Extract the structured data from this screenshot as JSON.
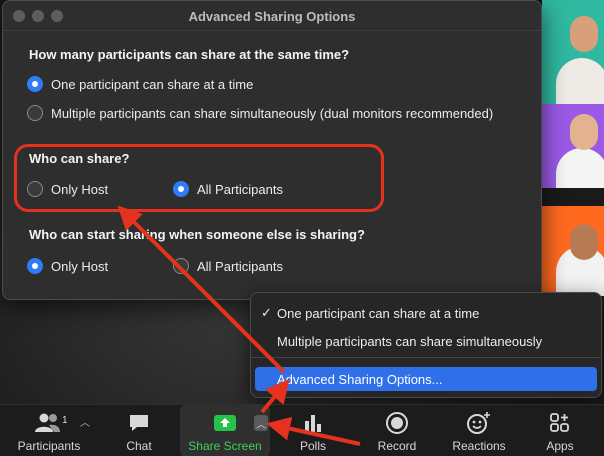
{
  "dialog": {
    "title": "Advanced Sharing Options",
    "sections": [
      {
        "heading": "How many participants can share at the same time?",
        "options": [
          {
            "label": "One participant can share at a time",
            "checked": true
          },
          {
            "label": "Multiple participants can share simultaneously (dual monitors recommended)",
            "checked": false
          }
        ]
      },
      {
        "heading": "Who can share?",
        "options": [
          {
            "label": "Only Host",
            "checked": false
          },
          {
            "label": "All Participants",
            "checked": true
          }
        ]
      },
      {
        "heading": "Who can start sharing when someone else is sharing?",
        "options": [
          {
            "label": "Only Host",
            "checked": true
          },
          {
            "label": "All Participants",
            "checked": false
          }
        ]
      }
    ]
  },
  "menu": {
    "items": [
      {
        "label": "One participant can share at a time",
        "checked": true
      },
      {
        "label": "Multiple participants can share simultaneously",
        "checked": false
      },
      {
        "label": "Advanced Sharing Options...",
        "selected": true
      }
    ],
    "check_glyph": "✓"
  },
  "toolbar": {
    "participants": {
      "label": "Participants",
      "count": "1",
      "icon": "participants-icon"
    },
    "chat": {
      "label": "Chat",
      "icon": "chat-icon"
    },
    "share": {
      "label": "Share Screen",
      "icon": "share-screen-icon",
      "color": "#3fd25a"
    },
    "polls": {
      "label": "Polls",
      "icon": "polls-icon"
    },
    "record": {
      "label": "Record",
      "icon": "record-icon"
    },
    "reactions": {
      "label": "Reactions",
      "icon": "reactions-icon"
    },
    "apps": {
      "label": "Apps",
      "icon": "apps-icon"
    }
  },
  "colors": {
    "accent": "#2f7df6",
    "annotation": "#e4321f",
    "share_green": "#3fd25a",
    "menu_highlight": "#2f6fe8"
  }
}
